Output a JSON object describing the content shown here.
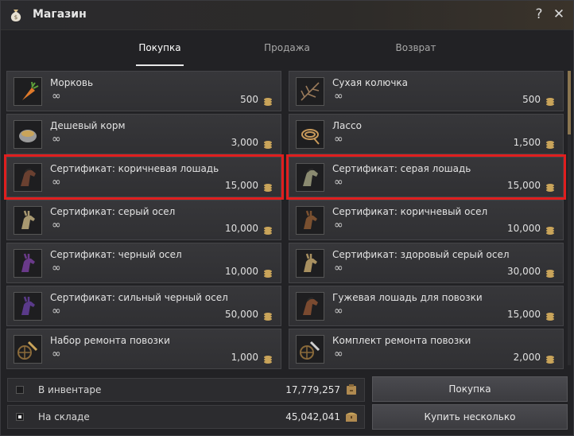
{
  "window": {
    "title": "Магазин"
  },
  "tabs": [
    {
      "label": "Покупка",
      "active": true
    },
    {
      "label": "Продажа",
      "active": false
    },
    {
      "label": "Возврат",
      "active": false
    }
  ],
  "items": [
    {
      "name": "Морковь",
      "qty": "∞",
      "price": "500",
      "icon": "carrot-icon"
    },
    {
      "name": "Сухая колючка",
      "qty": "∞",
      "price": "500",
      "icon": "dry-thorn-icon"
    },
    {
      "name": "Дешевый корм",
      "qty": "∞",
      "price": "3,000",
      "icon": "feed-bowl-icon"
    },
    {
      "name": "Лассо",
      "qty": "∞",
      "price": "1,500",
      "icon": "lasso-icon"
    },
    {
      "name": "Сертификат: коричневая лошадь",
      "qty": "∞",
      "price": "15,000",
      "icon": "brown-horse-icon",
      "highlighted": true
    },
    {
      "name": "Сертификат: серая лошадь",
      "qty": "∞",
      "price": "15,000",
      "icon": "grey-horse-icon",
      "highlighted": true
    },
    {
      "name": "Сертификат: серый осел",
      "qty": "∞",
      "price": "10,000",
      "icon": "grey-donkey-icon"
    },
    {
      "name": "Сертификат: коричневый осел",
      "qty": "∞",
      "price": "10,000",
      "icon": "brown-donkey-icon"
    },
    {
      "name": "Сертификат: черный осел",
      "qty": "∞",
      "price": "10,000",
      "icon": "black-donkey-icon"
    },
    {
      "name": "Сертификат: здоровый серый осел",
      "qty": "∞",
      "price": "30,000",
      "icon": "healthy-grey-donkey-icon"
    },
    {
      "name": "Сертификат: сильный черный осел",
      "qty": "∞",
      "price": "50,000",
      "icon": "strong-black-donkey-icon"
    },
    {
      "name": "Гужевая лошадь для повозки",
      "qty": "∞",
      "price": "15,000",
      "icon": "draft-horse-icon"
    },
    {
      "name": "Набор ремонта повозки",
      "qty": "∞",
      "price": "1,000",
      "icon": "repair-kit-icon"
    },
    {
      "name": "Комплект ремонта повозки",
      "qty": "∞",
      "price": "2,000",
      "icon": "repair-set-icon"
    }
  ],
  "footer": {
    "inventory": {
      "label": "В инвентаре",
      "value": "17,779,257",
      "checked": false
    },
    "storage": {
      "label": "На складе",
      "value": "45,042,041",
      "checked": true
    },
    "buy_label": "Покупка",
    "buy_many_label": "Купить несколько"
  },
  "colors": {
    "highlight": "#e01e1e",
    "coin": "#c9a45a"
  }
}
